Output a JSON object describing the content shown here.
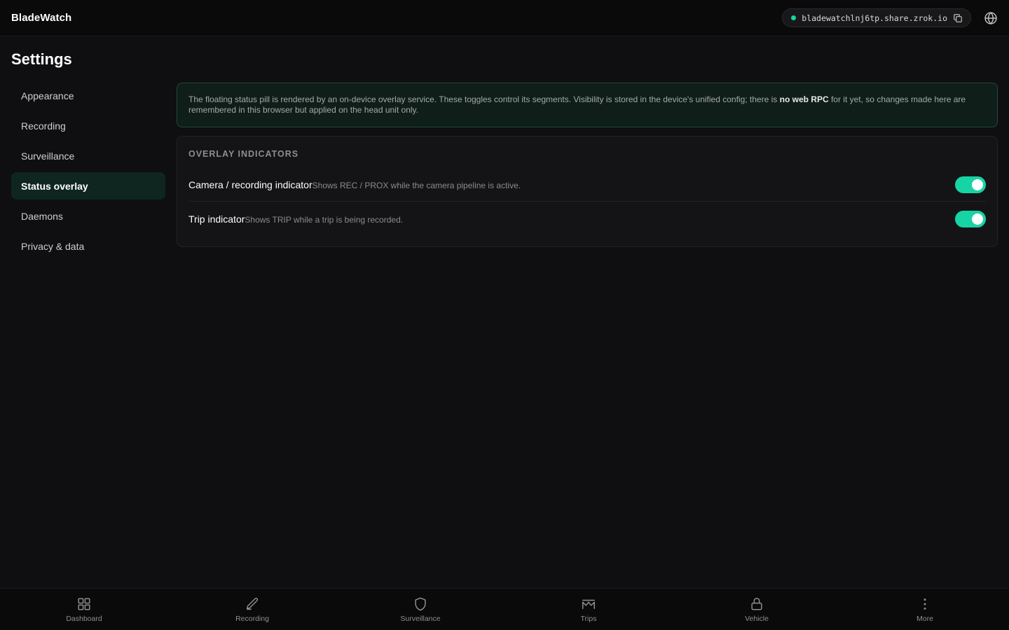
{
  "app": {
    "brand": "BladeWatch",
    "share_url": "bladewatchlnj6tp.share.zrok.io"
  },
  "page": {
    "title": "Settings"
  },
  "sidebar": {
    "items": [
      {
        "label": "Appearance"
      },
      {
        "label": "Recording"
      },
      {
        "label": "Surveillance"
      },
      {
        "label": "Status overlay"
      },
      {
        "label": "Daemons"
      },
      {
        "label": "Privacy & data"
      }
    ],
    "active": "Status overlay"
  },
  "banner": {
    "text_before": "The floating status pill is rendered by an on-device overlay service. These toggles control its segments. Visibility is stored in the device's unified config; there is ",
    "text_bold": "no web RPC",
    "text_after": " for it yet, so changes made here are remembered in this browser but applied on the head unit only."
  },
  "overlay": {
    "header": "OVERLAY INDICATORS",
    "rows": [
      {
        "title": "Camera / recording indicator",
        "desc": "Shows REC / PROX while the camera pipeline is active.",
        "enabled": true
      },
      {
        "title": "Trip indicator",
        "desc": "Shows TRIP while a trip is being recorded.",
        "enabled": true
      }
    ]
  },
  "bottom_nav": {
    "tabs": [
      {
        "label": "Dashboard",
        "icon": "grid-icon"
      },
      {
        "label": "Recording",
        "icon": "pen-icon"
      },
      {
        "label": "Surveillance",
        "icon": "shield-icon"
      },
      {
        "label": "Trips",
        "icon": "map-icon"
      },
      {
        "label": "Vehicle",
        "icon": "lock-icon"
      },
      {
        "label": "More",
        "icon": "more-vertical-icon"
      }
    ]
  },
  "colors": {
    "accent": "#17d4a4",
    "background": "#0f0f11",
    "active_nav_bg": "#0f2620"
  }
}
